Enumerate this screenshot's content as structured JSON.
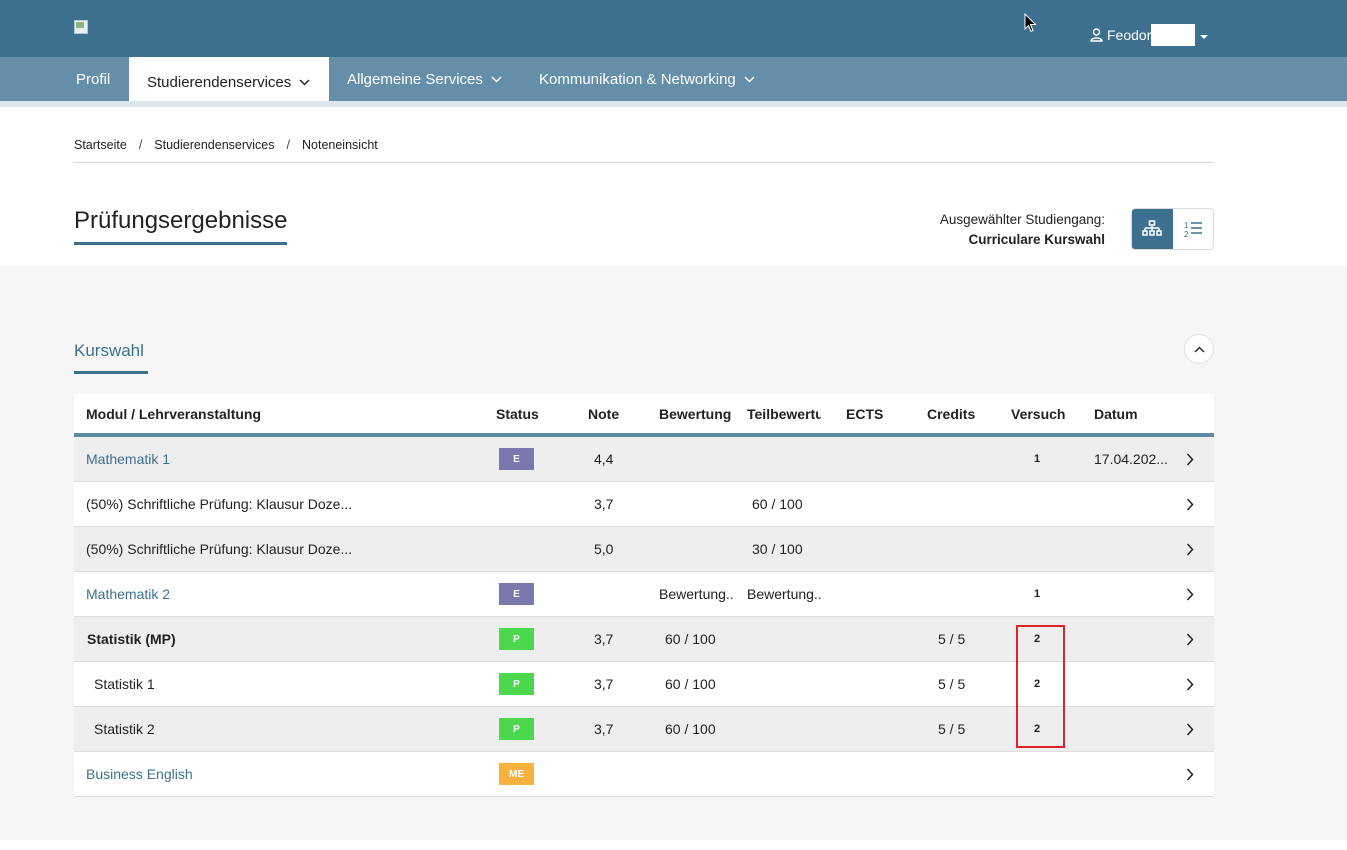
{
  "header": {
    "user_name": "Feodor"
  },
  "nav": {
    "items": [
      {
        "label": "Profil"
      },
      {
        "label": "Studierendenservices"
      },
      {
        "label": "Allgemeine Services"
      },
      {
        "label": "Kommunikation & Networking"
      }
    ]
  },
  "breadcrumb": [
    "Startseite",
    "Studierendenservices",
    "Noteneinsicht"
  ],
  "page": {
    "title": "Prüfungsergebnisse",
    "studiengang_label": "Ausgewählter Studiengang:",
    "studiengang_value": "Curriculare Kurswahl"
  },
  "section": {
    "title": "Kurswahl"
  },
  "table": {
    "columns": [
      "Modul / Lehrveranstaltung",
      "Status",
      "Note",
      "Bewertung",
      "Teilbewertu",
      "ECTS",
      "Credits",
      "Versuch",
      "Datum"
    ],
    "rows": [
      {
        "name": "Mathematik 1",
        "status": "E",
        "note": "4,4",
        "bewertung": "",
        "teilbewertung": "",
        "ects": "",
        "credits": "",
        "versuch": "1",
        "datum": "17.04.202..."
      },
      {
        "name": "(50%) Schriftliche Prüfung: Klausur Doze...",
        "status": "",
        "note": "3,7",
        "bewertung": "",
        "teilbewertung": "60 / 100",
        "ects": "",
        "credits": "",
        "versuch": "",
        "datum": ""
      },
      {
        "name": "(50%) Schriftliche Prüfung: Klausur Doze...",
        "status": "",
        "note": "5,0",
        "bewertung": "",
        "teilbewertung": "30 / 100",
        "ects": "",
        "credits": "",
        "versuch": "",
        "datum": ""
      },
      {
        "name": "Mathematik 2",
        "status": "E",
        "note": "",
        "bewertung": "Bewertung..",
        "teilbewertung": "Bewertung..",
        "ects": "",
        "credits": "",
        "versuch": "1",
        "datum": ""
      },
      {
        "name": "Statistik (MP)",
        "status": "P",
        "note": "3,7",
        "bewertung": "60 / 100",
        "teilbewertung": "",
        "ects": "",
        "credits": "5 / 5",
        "versuch": "2",
        "datum": ""
      },
      {
        "name": "Statistik 1",
        "status": "P",
        "note": "3,7",
        "bewertung": "60 / 100",
        "teilbewertung": "",
        "ects": "",
        "credits": "5 / 5",
        "versuch": "2",
        "datum": ""
      },
      {
        "name": "Statistik 2",
        "status": "P",
        "note": "3,7",
        "bewertung": "60 / 100",
        "teilbewertung": "",
        "ects": "",
        "credits": "5 / 5",
        "versuch": "2",
        "datum": ""
      },
      {
        "name": "Business English",
        "status": "ME",
        "note": "",
        "bewertung": "",
        "teilbewertung": "",
        "ects": "",
        "credits": "",
        "versuch": "",
        "datum": ""
      }
    ]
  },
  "colors": {
    "brand": "#3d708f",
    "nav": "#658fa9",
    "status_E": "#7b78ad",
    "status_P": "#4cd84c",
    "status_ME": "#f7b13d",
    "highlight": "#e0232b"
  }
}
